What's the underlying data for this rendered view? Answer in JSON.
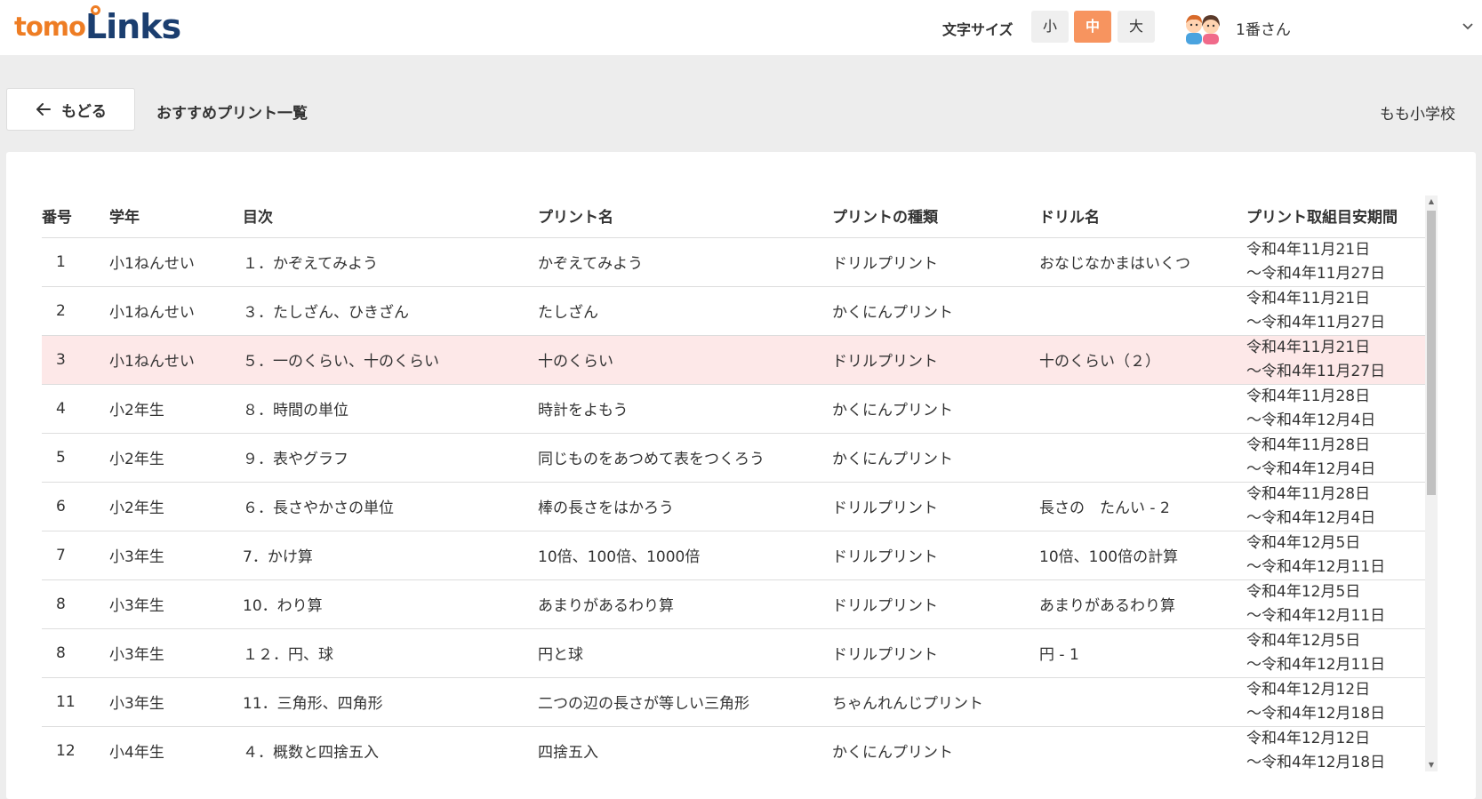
{
  "app": {
    "logo_prefix": "tomo",
    "logo_suffix": "Links"
  },
  "header": {
    "font_size_label": "文字サイズ",
    "font_sizes": [
      {
        "label": "小",
        "active": false
      },
      {
        "label": "中",
        "active": true
      },
      {
        "label": "大",
        "active": false
      }
    ],
    "user_name": "1番さん",
    "user_menu_icon": "chevron-down-icon"
  },
  "toolbar": {
    "back_label": "もどる",
    "back_icon": "arrow-left-icon",
    "page_title": "おすすめプリント一覧",
    "school_name": "もも小学校"
  },
  "colors": {
    "accent": "#f7945f",
    "logo_orange": "#ee7d24",
    "logo_navy": "#1b3e6f",
    "highlight_row": "#fde8e8"
  },
  "table": {
    "headers": [
      "番号",
      "学年",
      "目次",
      "プリント名",
      "プリントの種類",
      "ドリル名",
      "プリント取組目安期間"
    ],
    "rows": [
      {
        "no": "1",
        "grade": "小1ねんせい",
        "chapter": "１．かぞえてみよう",
        "print_name": "かぞえてみよう",
        "type": "ドリルプリント",
        "drill": "おなじなかまはいくつ",
        "period_start": "令和4年11月21日",
        "period_end": "～令和4年11月27日",
        "highlight": false
      },
      {
        "no": "2",
        "grade": "小1ねんせい",
        "chapter": "３．たしざん、ひきざん",
        "print_name": "たしざん",
        "type": "かくにんプリント",
        "drill": "",
        "period_start": "令和4年11月21日",
        "period_end": "～令和4年11月27日",
        "highlight": false
      },
      {
        "no": "3",
        "grade": "小1ねんせい",
        "chapter": "５．一のくらい、十のくらい",
        "print_name": "十のくらい",
        "type": "ドリルプリント",
        "drill": "十のくらい（２）",
        "period_start": "令和4年11月21日",
        "period_end": "～令和4年11月27日",
        "highlight": true
      },
      {
        "no": "4",
        "grade": "小2年生",
        "chapter": "８．時間の単位",
        "print_name": "時計をよもう",
        "type": "かくにんプリント",
        "drill": "",
        "period_start": "令和4年11月28日",
        "period_end": "～令和4年12月4日",
        "highlight": false
      },
      {
        "no": "5",
        "grade": "小2年生",
        "chapter": "９．表やグラフ",
        "print_name": "同じものをあつめて表をつくろう",
        "type": "かくにんプリント",
        "drill": "",
        "period_start": "令和4年11月28日",
        "period_end": "～令和4年12月4日",
        "highlight": false
      },
      {
        "no": "6",
        "grade": "小2年生",
        "chapter": "６．長さやかさの単位",
        "print_name": "棒の長さをはかろう",
        "type": "ドリルプリント",
        "drill": "長さの　たんい - 2",
        "period_start": "令和4年11月28日",
        "period_end": "～令和4年12月4日",
        "highlight": false
      },
      {
        "no": "7",
        "grade": "小3年生",
        "chapter": "7．かけ算",
        "print_name": "10倍、100倍、1000倍",
        "type": "ドリルプリント",
        "drill": "10倍、100倍の計算",
        "period_start": "令和4年12月5日",
        "period_end": "～令和4年12月11日",
        "highlight": false
      },
      {
        "no": "8",
        "grade": "小3年生",
        "chapter": "10．わり算",
        "print_name": "あまりがあるわり算",
        "type": "ドリルプリント",
        "drill": "あまりがあるわり算",
        "period_start": "令和4年12月5日",
        "period_end": "～令和4年12月11日",
        "highlight": false
      },
      {
        "no": "8",
        "grade": "小3年生",
        "chapter": "１２．円、球",
        "print_name": "円と球",
        "type": "ドリルプリント",
        "drill": "円 - 1",
        "period_start": "令和4年12月5日",
        "period_end": "～令和4年12月11日",
        "highlight": false
      },
      {
        "no": "11",
        "grade": "小3年生",
        "chapter": "11．三角形、四角形",
        "print_name": "二つの辺の長さが等しい三角形",
        "type": "ちゃんれんじプリント",
        "drill": "",
        "period_start": "令和4年12月12日",
        "period_end": "～令和4年12月18日",
        "highlight": false
      },
      {
        "no": "12",
        "grade": "小4年生",
        "chapter": "４．概数と四捨五入",
        "print_name": "四捨五入",
        "type": "かくにんプリント",
        "drill": "",
        "period_start": "令和4年12月12日",
        "period_end": "～令和4年12月18日",
        "highlight": false
      }
    ]
  }
}
